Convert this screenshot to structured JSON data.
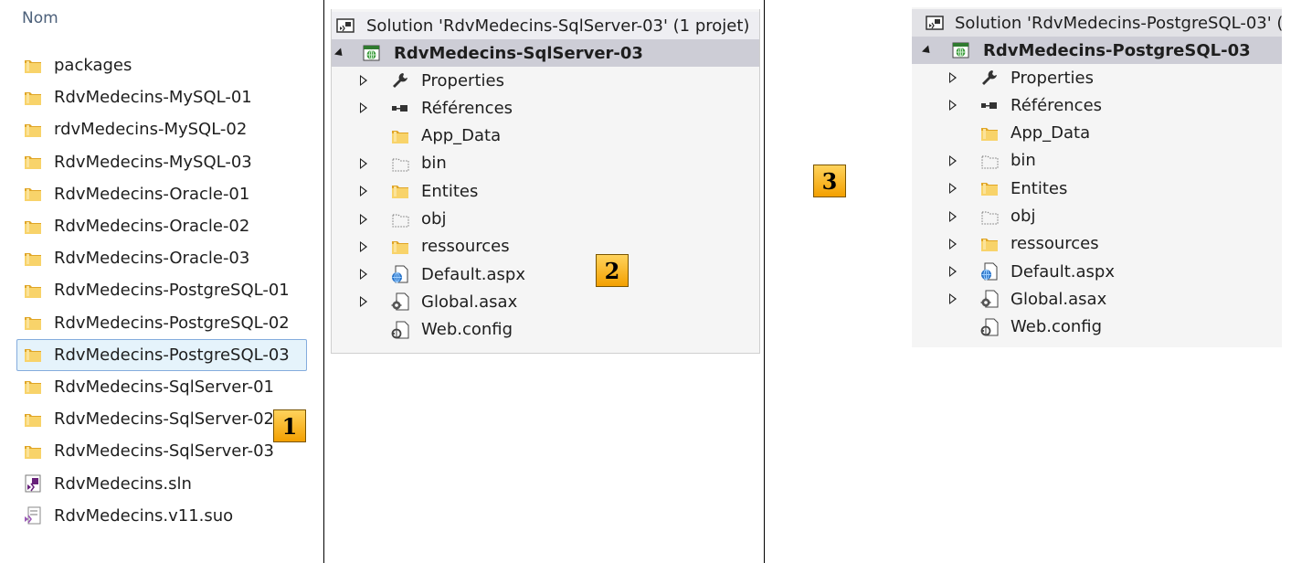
{
  "explorer": {
    "header": "Nom",
    "items": [
      {
        "label": "packages",
        "icon": "folder-icon"
      },
      {
        "label": "RdvMedecins-MySQL-01",
        "icon": "folder-icon"
      },
      {
        "label": "rdvMedecins-MySQL-02",
        "icon": "folder-icon"
      },
      {
        "label": "RdvMedecins-MySQL-03",
        "icon": "folder-icon"
      },
      {
        "label": "RdvMedecins-Oracle-01",
        "icon": "folder-icon"
      },
      {
        "label": "RdvMedecins-Oracle-02",
        "icon": "folder-icon"
      },
      {
        "label": "RdvMedecins-Oracle-03",
        "icon": "folder-icon"
      },
      {
        "label": "RdvMedecins-PostgreSQL-01",
        "icon": "folder-icon"
      },
      {
        "label": "RdvMedecins-PostgreSQL-02",
        "icon": "folder-icon"
      },
      {
        "label": "RdvMedecins-PostgreSQL-03",
        "icon": "folder-icon",
        "selected": true
      },
      {
        "label": "RdvMedecins-SqlServer-01",
        "icon": "folder-icon"
      },
      {
        "label": "RdvMedecins-SqlServer-02",
        "icon": "folder-icon"
      },
      {
        "label": "RdvMedecins-SqlServer-03",
        "icon": "folder-icon"
      },
      {
        "label": "RdvMedecins.sln",
        "icon": "vs-solution-file-icon"
      },
      {
        "label": "RdvMedecins.v11.suo",
        "icon": "vs-user-options-file-icon"
      }
    ]
  },
  "solution_sqlserver": {
    "solution_label": "Solution 'RdvMedecins-SqlServer-03' (1 projet)",
    "project_label": "RdvMedecins-SqlServer-03",
    "items": [
      {
        "label": "Properties",
        "icon": "wrench-icon",
        "expandable": true
      },
      {
        "label": "Références",
        "icon": "references-icon",
        "expandable": true
      },
      {
        "label": "App_Data",
        "icon": "folder-icon",
        "expandable": false
      },
      {
        "label": "bin",
        "icon": "dotted-folder-icon",
        "expandable": true
      },
      {
        "label": "Entites",
        "icon": "folder-icon",
        "expandable": true
      },
      {
        "label": "obj",
        "icon": "dotted-folder-icon",
        "expandable": true
      },
      {
        "label": "ressources",
        "icon": "folder-icon",
        "expandable": true
      },
      {
        "label": "Default.aspx",
        "icon": "web-page-icon",
        "expandable": true
      },
      {
        "label": "Global.asax",
        "icon": "global-asax-icon",
        "expandable": true
      },
      {
        "label": "Web.config",
        "icon": "config-file-icon",
        "expandable": false
      }
    ]
  },
  "solution_postgresql": {
    "solution_label": "Solution 'RdvMedecins-PostgreSQL-03' (",
    "project_label": "RdvMedecins-PostgreSQL-03",
    "items": [
      {
        "label": "Properties",
        "icon": "wrench-icon",
        "expandable": true
      },
      {
        "label": "Références",
        "icon": "references-icon",
        "expandable": true
      },
      {
        "label": "App_Data",
        "icon": "folder-icon",
        "expandable": false
      },
      {
        "label": "bin",
        "icon": "dotted-folder-icon",
        "expandable": true
      },
      {
        "label": "Entites",
        "icon": "folder-icon",
        "expandable": true
      },
      {
        "label": "obj",
        "icon": "dotted-folder-icon",
        "expandable": true
      },
      {
        "label": "ressources",
        "icon": "folder-icon",
        "expandable": true
      },
      {
        "label": "Default.aspx",
        "icon": "web-page-icon",
        "expandable": true
      },
      {
        "label": "Global.asax",
        "icon": "global-asax-icon",
        "expandable": true
      },
      {
        "label": "Web.config",
        "icon": "config-file-icon",
        "expandable": false
      }
    ]
  },
  "badges": {
    "one": "1",
    "two": "2",
    "three": "3"
  },
  "colors": {
    "selection_bg": "#e5f3fb",
    "selection_border": "#84acdd",
    "project_row_bg": "#cdcdd6",
    "badge_gradient_top": "#ffd35c",
    "badge_gradient_bottom": "#f3a000",
    "folder_yellow": "#f1c232"
  }
}
